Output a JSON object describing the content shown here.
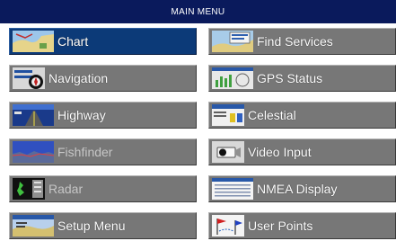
{
  "title": "MAIN MENU",
  "left_column": [
    {
      "label": "Chart",
      "icon": "chart-icon",
      "selected": true,
      "enabled": true
    },
    {
      "label": "Navigation",
      "icon": "navigation-icon",
      "selected": false,
      "enabled": true
    },
    {
      "label": "Highway",
      "icon": "highway-icon",
      "selected": false,
      "enabled": true
    },
    {
      "label": "Fishfinder",
      "icon": "fishfinder-icon",
      "selected": false,
      "enabled": false
    },
    {
      "label": "Radar",
      "icon": "radar-icon",
      "selected": false,
      "enabled": false
    },
    {
      "label": "Setup Menu",
      "icon": "setup-menu-icon",
      "selected": false,
      "enabled": true
    }
  ],
  "right_column": [
    {
      "label": "Find Services",
      "icon": "find-services-icon",
      "selected": false,
      "enabled": true
    },
    {
      "label": "GPS Status",
      "icon": "gps-status-icon",
      "selected": false,
      "enabled": true
    },
    {
      "label": "Celestial",
      "icon": "celestial-icon",
      "selected": false,
      "enabled": true
    },
    {
      "label": "Video Input",
      "icon": "video-input-icon",
      "selected": false,
      "enabled": true
    },
    {
      "label": "NMEA Display",
      "icon": "nmea-display-icon",
      "selected": false,
      "enabled": true
    },
    {
      "label": "User Points",
      "icon": "user-points-icon",
      "selected": false,
      "enabled": true
    }
  ],
  "colors": {
    "title_bar": "#0a1a5c",
    "selected_item": "#0c3a78",
    "item": "#777777",
    "label": "#ffffff",
    "disabled_label": "#c6c6c6"
  }
}
